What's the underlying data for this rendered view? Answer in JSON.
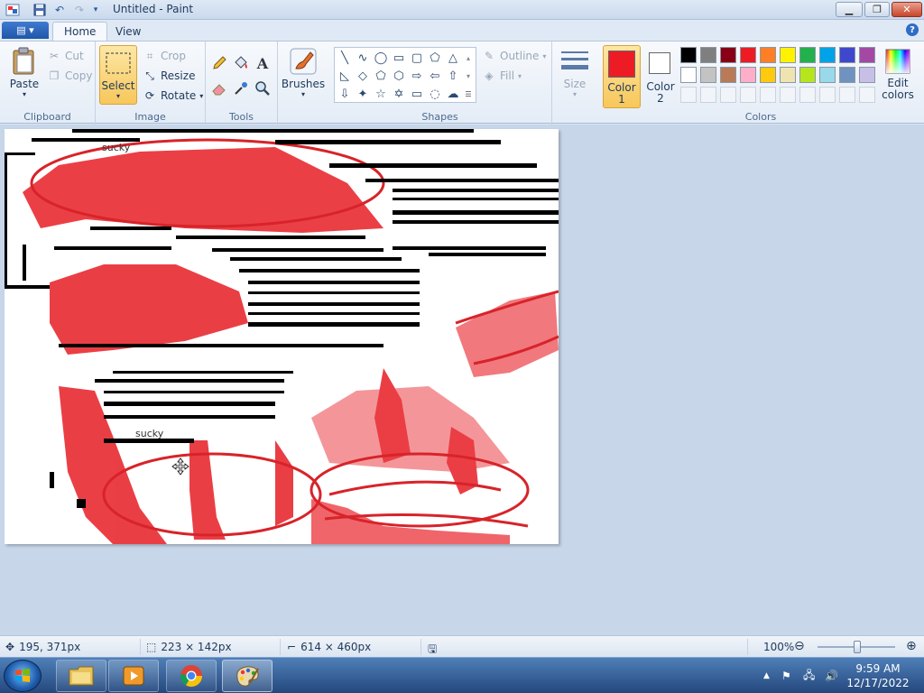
{
  "window": {
    "title": "Untitled - Paint"
  },
  "tabs": [
    {
      "label": "Home",
      "active": true
    },
    {
      "label": "View",
      "active": false
    }
  ],
  "ribbon": {
    "clipboard": {
      "label": "Clipboard",
      "paste": "Paste",
      "cut": "Cut",
      "copy": "Copy"
    },
    "image": {
      "label": "Image",
      "select": "Select",
      "crop": "Crop",
      "resize": "Resize",
      "rotate": "Rotate"
    },
    "tools": {
      "label": "Tools"
    },
    "brushes": {
      "label": "Brushes"
    },
    "shapes": {
      "label": "Shapes",
      "outline": "Outline",
      "fill": "Fill"
    },
    "size": {
      "label": "Size"
    },
    "colors": {
      "label": "Colors",
      "color1": "Color 1",
      "color2": "Color 2",
      "edit": "Edit colors",
      "color1_value": "#ed1c24",
      "color2_value": "#ffffff",
      "palette_row1": [
        "#000000",
        "#7f7f7f",
        "#880015",
        "#ed1c24",
        "#ff7f27",
        "#fff200",
        "#22b14c",
        "#00a2e8",
        "#3f48cc",
        "#a349a4"
      ],
      "palette_row2": [
        "#ffffff",
        "#c3c3c3",
        "#b97a57",
        "#ffaec9",
        "#ffc90e",
        "#efe4b0",
        "#b5e61d",
        "#99d9ea",
        "#7092be",
        "#c8bfe7"
      ]
    }
  },
  "canvas": {
    "text_1": "sucky",
    "text_2": "sucky"
  },
  "status": {
    "cursor_pos": "195, 371px",
    "selection_size": "223 × 142px",
    "canvas_size": "614 × 460px",
    "zoom": "100%"
  },
  "taskbar": {
    "time": "9:59 AM",
    "date": "12/17/2022"
  }
}
